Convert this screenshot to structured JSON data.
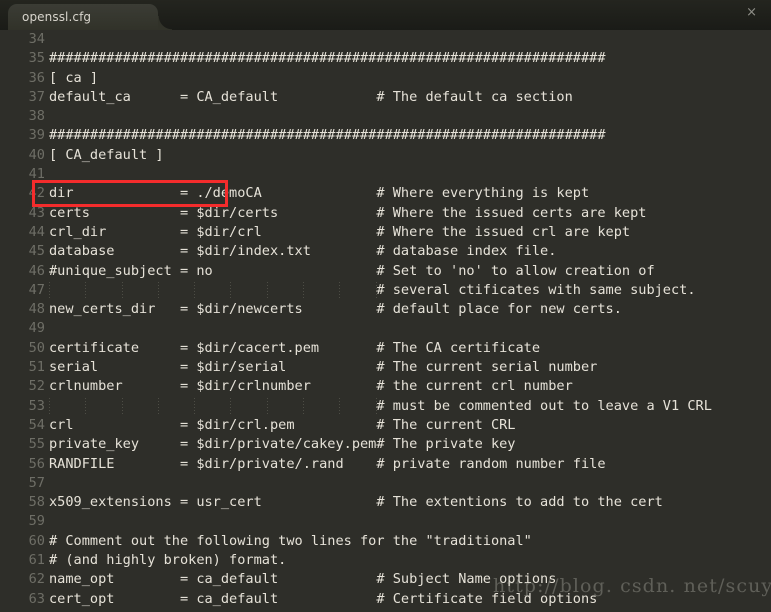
{
  "window": {
    "tab": {
      "label": "openssl.cfg",
      "close_glyph": "×"
    }
  },
  "editor": {
    "first_line_number": 34,
    "colors": {
      "background": "#2e2e29",
      "text": "#e6e2d8",
      "line_number": "#6e6e66",
      "highlight_box": "#f42c2c",
      "tab_bar": "#1d1f1c"
    },
    "lines": [
      {
        "n": "34",
        "t": ""
      },
      {
        "n": "35",
        "t": "####################################################################"
      },
      {
        "n": "36",
        "t": "[ ca ]"
      },
      {
        "n": "37",
        "t": "default_ca\t= CA_default\t\t# The default ca section"
      },
      {
        "n": "38",
        "t": ""
      },
      {
        "n": "39",
        "t": "####################################################################"
      },
      {
        "n": "40",
        "t": "[ CA_default ]"
      },
      {
        "n": "41",
        "t": ""
      },
      {
        "n": "42",
        "t": "dir\t\t= ./demoCA\t\t# Where everything is kept"
      },
      {
        "n": "43",
        "t": "certs\t\t= $dir/certs\t\t# Where the issued certs are kept"
      },
      {
        "n": "44",
        "t": "crl_dir\t\t= $dir/crl\t\t# Where the issued crl are kept"
      },
      {
        "n": "45",
        "t": "database\t= $dir/index.txt\t# database index file."
      },
      {
        "n": "46",
        "t": "#unique_subject\t= no\t\t\t# Set to 'no' to allow creation of"
      },
      {
        "n": "47",
        "t": "\t\t\t\t\t# several ctificates with same subject."
      },
      {
        "n": "48",
        "t": "new_certs_dir\t= $dir/newcerts\t\t# default place for new certs."
      },
      {
        "n": "49",
        "t": ""
      },
      {
        "n": "50",
        "t": "certificate\t= $dir/cacert.pem \t# The CA certificate"
      },
      {
        "n": "51",
        "t": "serial\t\t= $dir/serial\t\t# The current serial number"
      },
      {
        "n": "52",
        "t": "crlnumber\t= $dir/crlnumber\t# the current crl number"
      },
      {
        "n": "53",
        "t": "\t\t\t\t\t# must be commented out to leave a V1 CRL"
      },
      {
        "n": "54",
        "t": "crl\t\t= $dir/crl.pem \t\t# The current CRL"
      },
      {
        "n": "55",
        "t": "private_key\t= $dir/private/cakey.pem# The private key"
      },
      {
        "n": "56",
        "t": "RANDFILE\t= $dir/private/.rand\t# private random number file"
      },
      {
        "n": "57",
        "t": ""
      },
      {
        "n": "58",
        "t": "x509_extensions\t= usr_cert\t\t# The extentions to add to the cert"
      },
      {
        "n": "59",
        "t": ""
      },
      {
        "n": "60",
        "t": "# Comment out the following two lines for the \"traditional\""
      },
      {
        "n": "61",
        "t": "# (and highly broken) format."
      },
      {
        "n": "62",
        "t": "name_opt\t= ca_default\t\t# Subject Name options"
      },
      {
        "n": "63",
        "t": "cert_opt\t= ca_default\t\t# Certificate field options"
      }
    ],
    "highlighted_line": "dir\t\t= ./demoCA"
  },
  "watermark": {
    "text": "http://blog. csdn. net/scuyxi"
  }
}
